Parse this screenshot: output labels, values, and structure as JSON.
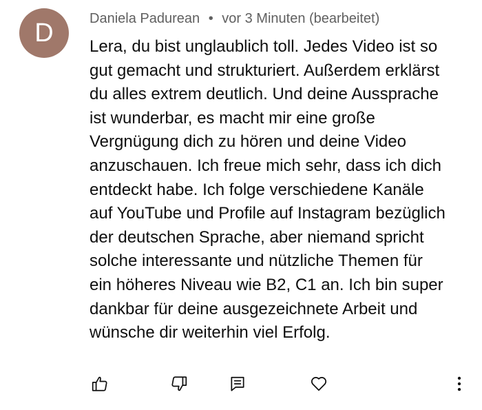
{
  "comment": {
    "avatar_letter": "D",
    "avatar_color": "#a0786a",
    "author": "Daniela Padurean",
    "separator": "•",
    "time": "vor 3 Minuten (bearbeitet)",
    "body_lines": [
      "Lera, du bist unglaublich toll. Jedes Video ist so",
      "gut gemacht und strukturiert. Außerdem erklärst",
      "du alles extrem deutlich. Und deine Aussprache",
      "ist wunderbar, es macht mir eine große",
      "Vergnügung dich zu hören und deine Video",
      "anzuschauen. Ich freue mich sehr, dass ich dich",
      "entdeckt habe. Ich folge verschiedene Kanäle",
      "auf YouTube und Profile auf Instagram bezüglich",
      "der deutschen Sprache, aber niemand spricht",
      "solche interessante und nützliche Themen für",
      "ein höheres Niveau wie B2, C1 an. Ich bin super",
      "dankbar für deine ausgezeichnete Arbeit und",
      "wünsche dir weiterhin viel Erfolg."
    ]
  },
  "actions": {
    "like_icon": "thumb-up-icon",
    "dislike_icon": "thumb-down-icon",
    "reply_icon": "reply-comment-icon",
    "heart_icon": "heart-icon",
    "more_icon": "more-vertical-icon"
  }
}
